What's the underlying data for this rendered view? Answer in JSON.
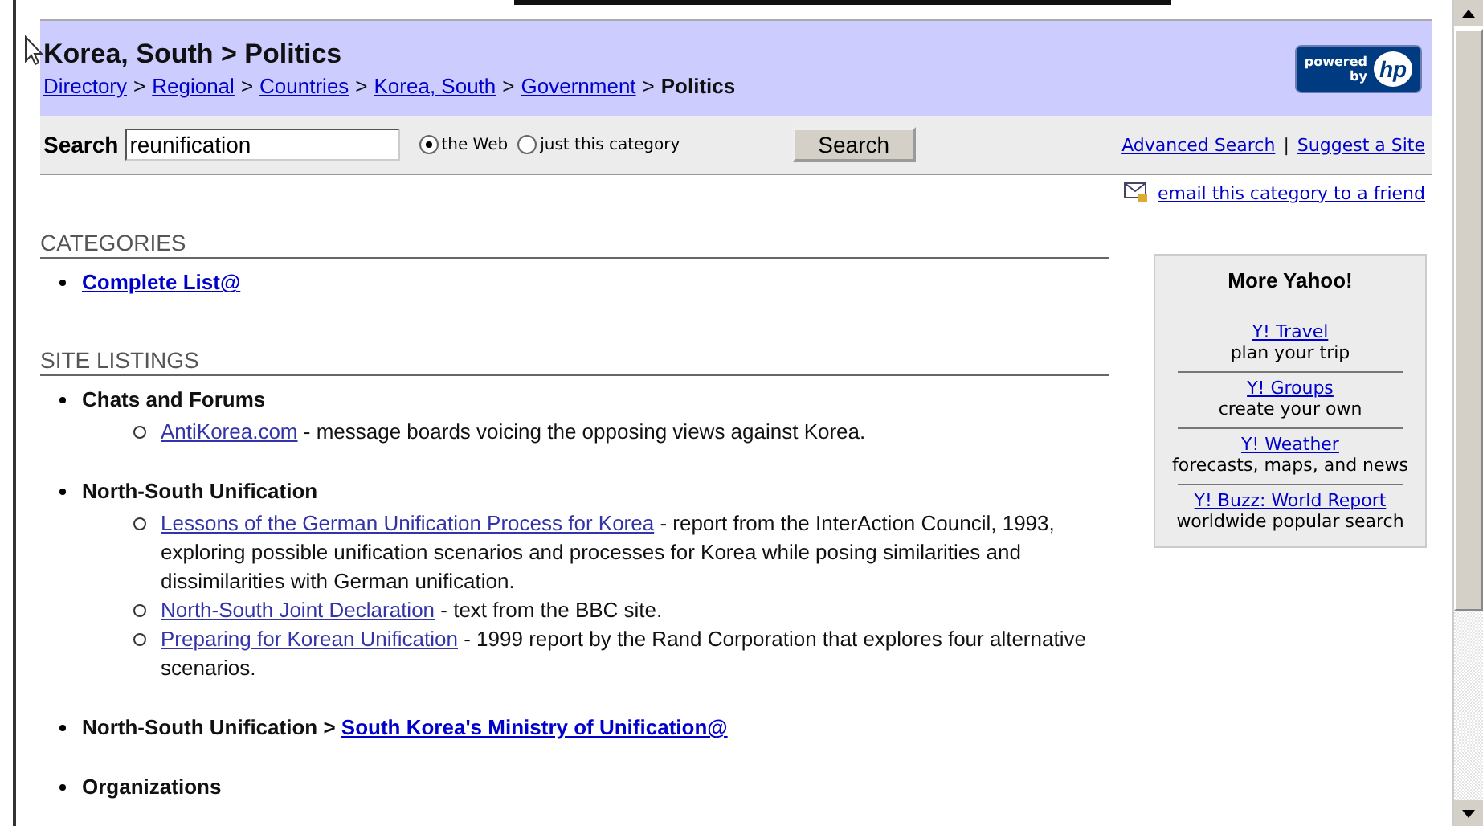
{
  "header": {
    "title": "Korea, South > Politics",
    "breadcrumb": [
      {
        "label": "Directory",
        "link": true
      },
      {
        "label": "Regional",
        "link": true
      },
      {
        "label": "Countries",
        "link": true
      },
      {
        "label": "Korea, South",
        "link": true
      },
      {
        "label": "Government",
        "link": true
      },
      {
        "label": "Politics",
        "link": false
      }
    ],
    "separator": ">",
    "logo": {
      "line_1": "powered",
      "line_2": "by",
      "mark": "hp"
    }
  },
  "search": {
    "label": "Search",
    "value": "reunification",
    "options": [
      {
        "label": "the Web",
        "selected": true
      },
      {
        "label": "just this category",
        "selected": false
      }
    ],
    "button": "Search",
    "links": [
      "Advanced Search",
      "Suggest a Site"
    ],
    "link_separator": "|"
  },
  "email_link": "email this category to a friend",
  "sections": [
    {
      "heading": "CATEGORIES",
      "items": [
        {
          "kind": "link",
          "label": "Complete List@"
        }
      ]
    },
    {
      "heading": "SITE LISTINGS",
      "items": [
        {
          "kind": "group",
          "label": "Chats and Forums",
          "children": [
            {
              "link": "AntiKorea.com",
              "text": " - message boards voicing the opposing views against Korea."
            }
          ]
        },
        {
          "kind": "group",
          "label": "North-South Unification",
          "children": [
            {
              "link": "Lessons of the German Unification Process for Korea",
              "text": " - report from the InterAction Council, 1993, exploring possible unification scenarios and processes for Korea while posing similarities and dissimilarities with German unification."
            },
            {
              "link": "North-South Joint Declaration",
              "text": " - text from the BBC site."
            },
            {
              "link": "Preparing for Korean Unification",
              "text": " - 1999 report by the Rand Corporation that explores four alternative scenarios."
            }
          ]
        },
        {
          "kind": "crosslink",
          "label": "North-South Unification >",
          "link": "South Korea's Ministry of Unification@"
        },
        {
          "kind": "group",
          "label": "Organizations"
        }
      ]
    }
  ],
  "sidebar": {
    "title": "More Yahoo!",
    "items": [
      {
        "link": "Y! Travel",
        "text": "plan your trip"
      },
      {
        "link": "Y! Groups",
        "text": "create your own"
      },
      {
        "link": "Y! Weather",
        "text": "forecasts, maps, and news"
      },
      {
        "link": "Y! Buzz: World Report",
        "text": "worldwide popular search"
      }
    ]
  }
}
